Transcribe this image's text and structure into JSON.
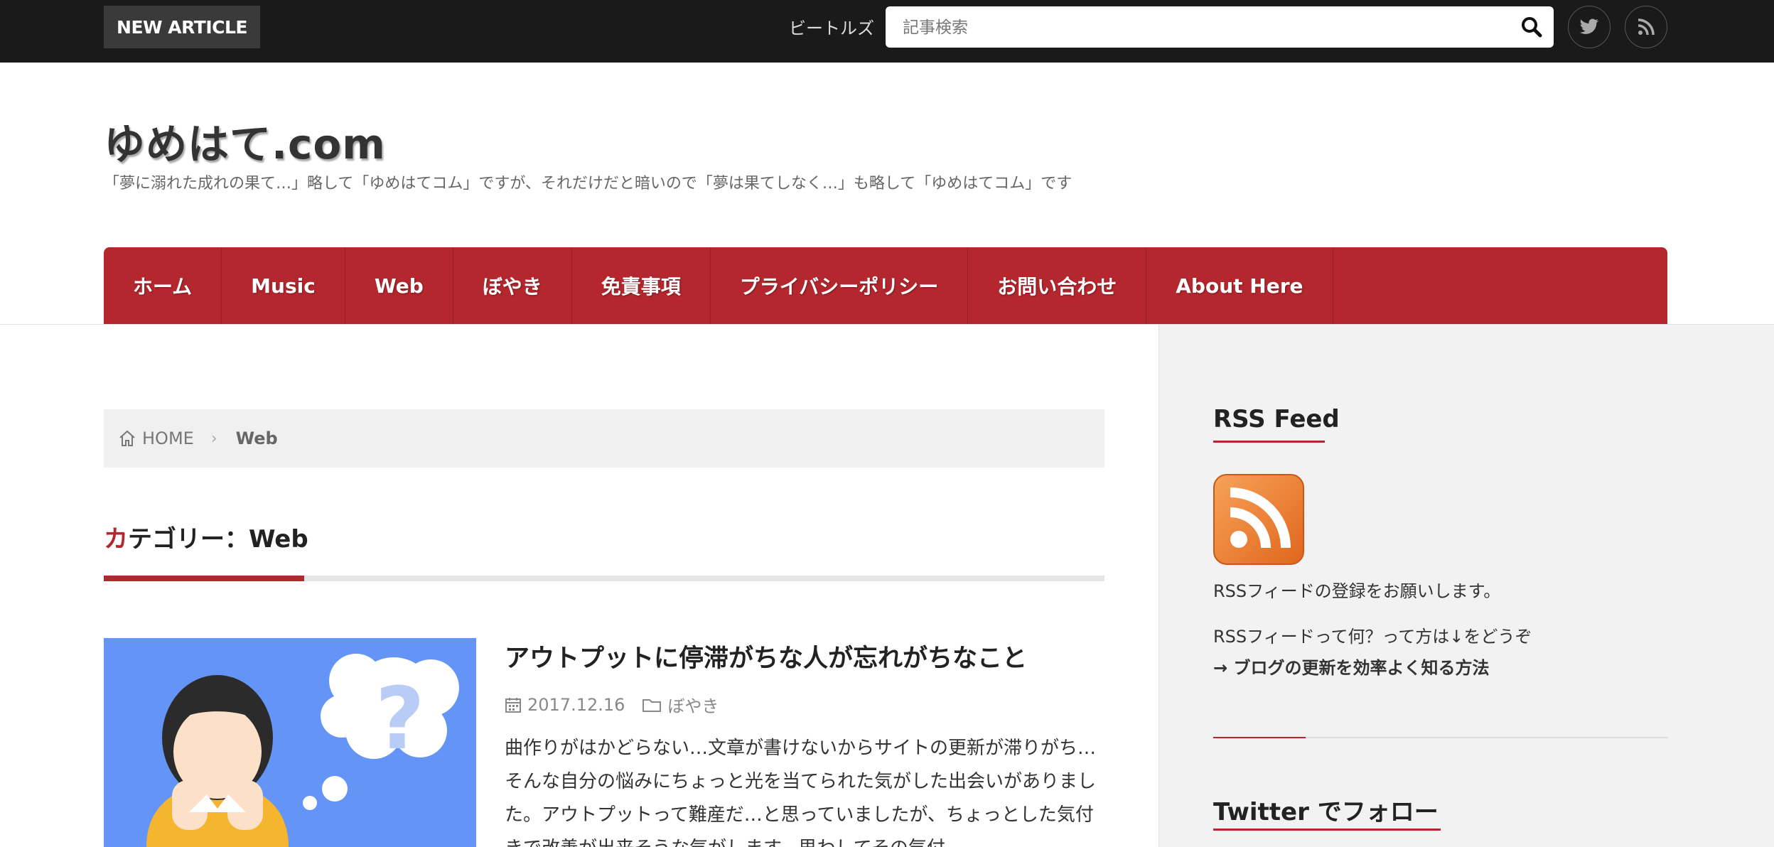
{
  "topbar": {
    "new_article_label": "NEW ARTICLE",
    "keyword": "ビートルズ",
    "search_placeholder": "記事検索",
    "social_icons": [
      "twitter-icon",
      "rss-icon"
    ]
  },
  "site": {
    "title": "ゆめはて.com",
    "description": "「夢に溺れた成れの果て…」略して「ゆめはてコム」ですが、それだけだと暗いので「夢は果てしなく…」も略して「ゆめはてコム」です"
  },
  "nav": {
    "items": [
      "ホーム",
      "Music",
      "Web",
      "ぼやき",
      "免責事項",
      "プライバシーポリシー",
      "お問い合わせ",
      "About Here"
    ]
  },
  "breadcrumb": {
    "home": "HOME",
    "current": "Web"
  },
  "category": {
    "first_char": "カ",
    "rest": "テゴリー：Web"
  },
  "article": {
    "title": "アウトプットに停滞がちな人が忘れがちなこと",
    "date": "2017.12.16",
    "category": "ぼやき",
    "excerpt": "曲作りがはかどらない…文章が書けないからサイトの更新が滞りがち…そんな自分の悩みにちょっと光を当てられた気がした出会いがありました。アウトプットって難産だ…と思っていましたが、ちょっとした気付きで改善が出来そうな気がします。思わしてその気付"
  },
  "sidebar": {
    "rss_title": "RSS Feed",
    "rss_text1": "RSSフィードの登録をお願いします。",
    "rss_text2": "RSSフィードって何？って方は↓をどうぞ",
    "rss_link": "→ ブログの更新を効率よく知る方法",
    "twitter_title": "Twitter でフォロー"
  },
  "colors": {
    "accent": "#b5272e",
    "topbar": "#1a1a1a",
    "thumb_bg": "#6495f6",
    "sidebar_bg": "#f2f2f2"
  }
}
